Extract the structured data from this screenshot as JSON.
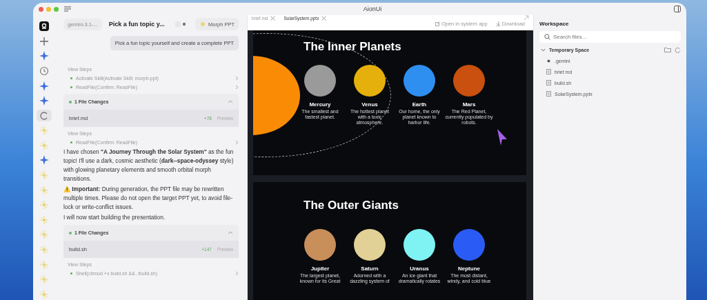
{
  "window": {
    "title": "AionUi"
  },
  "rail": [
    {
      "kind": "logo",
      "selected": false
    },
    {
      "kind": "plus",
      "selected": false
    },
    {
      "kind": "sparkle",
      "selected": false
    },
    {
      "kind": "clock",
      "selected": false
    },
    {
      "kind": "sparkle",
      "selected": false
    },
    {
      "kind": "sparkle",
      "selected": false
    },
    {
      "kind": "spinner",
      "selected": true
    },
    {
      "kind": "sun",
      "selected": false
    },
    {
      "kind": "sun",
      "selected": false
    },
    {
      "kind": "sparkle",
      "selected": false
    },
    {
      "kind": "sun",
      "selected": false
    },
    {
      "kind": "sun",
      "selected": false
    },
    {
      "kind": "sun",
      "selected": false
    },
    {
      "kind": "sun",
      "selected": false
    },
    {
      "kind": "sun",
      "selected": false
    },
    {
      "kind": "sun",
      "selected": false
    },
    {
      "kind": "sun",
      "selected": false
    },
    {
      "kind": "sun",
      "selected": false
    },
    {
      "kind": "sun",
      "selected": false
    }
  ],
  "chat_header": {
    "model": "gemini-3.1-...",
    "title": "Pick a fun topic y...",
    "skill": "Morph PPT"
  },
  "messages": [
    {
      "kind": "user",
      "text": "Pick a fun topic yourself and create a complete PPT"
    },
    {
      "kind": "steps",
      "label": "View Steps",
      "steps": [
        "Activate Skill(Activate Skill: morph-ppt)",
        "ReadFile(Confirm: ReadFile)"
      ]
    },
    {
      "kind": "files",
      "label": "1 File Changes",
      "file": "brief.md",
      "added": "+78",
      "action": "Preview"
    },
    {
      "kind": "steps",
      "label": "View Steps",
      "steps": [
        "ReadFile(Confirm: ReadFile)"
      ]
    },
    {
      "kind": "text",
      "paragraphs": [
        "I have chosen **\"A Journey Through the Solar System\"** as the fun topic! I'll use a dark, cosmic aesthetic (**dark--space-odyssey** style) with glowing planetary elements and smooth orbital morph transitions.",
        "⚠️ **Important:** During generation, the PPT file may be rewritten multiple times. Please do not open the target PPT yet, to avoid file-lock or write-conflict issues.",
        "I will now start building the presentation."
      ]
    },
    {
      "kind": "files",
      "label": "1 File Changes",
      "file": "build.sh",
      "added": "+147",
      "action": "Preview"
    },
    {
      "kind": "steps",
      "label": "View Steps",
      "steps": [
        "Shell(chmod +x build.sh && ./build.sh)"
      ]
    }
  ],
  "preview": {
    "tabs": [
      {
        "label": "brief.md",
        "selected": false
      },
      {
        "label": "SolarSystem.pptx",
        "selected": true
      }
    ],
    "actions": [
      "Open in system app",
      "Download"
    ],
    "slides": [
      {
        "title": "The Inner Planets",
        "sun": true,
        "planets": [
          {
            "name": "Mercury",
            "color": "#9a9a9a",
            "text": "The smallest and fastest planet."
          },
          {
            "name": "Venus",
            "color": "#e6b00c",
            "text": "The hottest planet with a toxic atmosphere."
          },
          {
            "name": "Earth",
            "color": "#2f8ff0",
            "text": "Our home, the only planet known to harbor life."
          },
          {
            "name": "Mars",
            "color": "#c9500e",
            "text": "The Red Planet, currently populated by robots."
          }
        ]
      },
      {
        "title": "The Outer Giants",
        "sun": false,
        "planets": [
          {
            "name": "Jupiter",
            "color": "#c98f5a",
            "text": "The largest planet, known for its Great"
          },
          {
            "name": "Saturn",
            "color": "#e2d196",
            "text": "Adorned with a dazzling system of"
          },
          {
            "name": "Uranus",
            "color": "#7ff3f3",
            "text": "An ice giant that dramatically rotates"
          },
          {
            "name": "Neptune",
            "color": "#2a5cf5",
            "text": "The most distant, windy, and cold blue"
          }
        ]
      }
    ]
  },
  "workspace": {
    "title": "Workspace",
    "search": {
      "placeholder": "Search files..."
    },
    "tree": [
      {
        "label": "Temporary Space",
        "kind": "folder",
        "expanded": true,
        "children": [
          {
            "label": ".gemini",
            "kind": "dot"
          },
          {
            "label": "brief.md",
            "kind": "file"
          },
          {
            "label": "build.sh",
            "kind": "file"
          },
          {
            "label": "SolarSystem.pptx",
            "kind": "file"
          }
        ]
      }
    ]
  }
}
